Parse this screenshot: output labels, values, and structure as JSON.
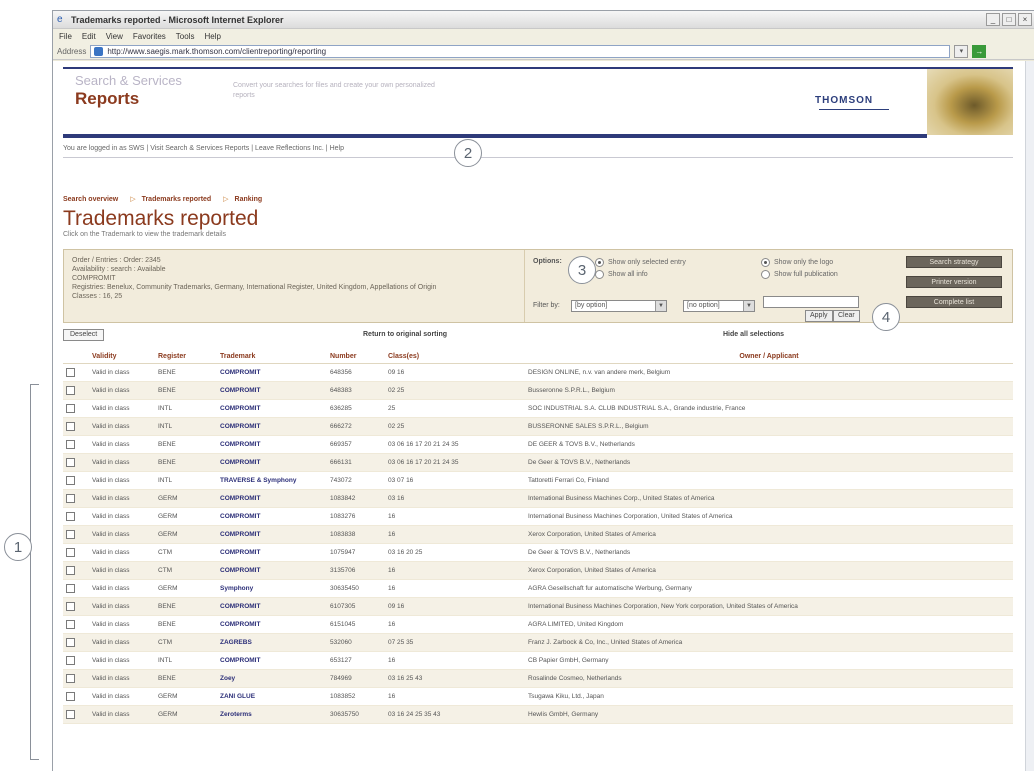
{
  "browser": {
    "title": "Trademarks reported - Microsoft Internet Explorer",
    "menu": [
      "File",
      "Edit",
      "View",
      "Favorites",
      "Tools",
      "Help"
    ],
    "address_label": "Address",
    "url": "http://www.saegis.mark.thomson.com/clientreporting/reporting"
  },
  "header": {
    "brand_small": "Search & Services",
    "brand_big": "Reports",
    "description": "Convert your searches for files and create your own personalized reports",
    "logo": "THOMSON"
  },
  "usernav": {
    "logged_in": "You are logged in as SWS",
    "links": [
      "Visit Search & Services Reports",
      "Leave Reflections Inc.",
      "Help"
    ]
  },
  "breadcrumb": [
    "Search overview",
    "Trademarks reported",
    "Ranking"
  ],
  "page": {
    "title": "Trademarks reported",
    "subtitle": "Click on the Trademark to view the trademark details"
  },
  "panel": {
    "info": [
      "Order / Entries : Order: 2345",
      "Availability : search : Available",
      "COMPROMIT",
      "Registries: Benelux, Community Trademarks, Germany, International Register, United Kingdom, Appellations of Origin",
      "Classes : 16, 25"
    ],
    "options_label": "Options:",
    "radios": [
      {
        "label": "Show only selected entry",
        "checked": true
      },
      {
        "label": "Show all info",
        "checked": false
      },
      {
        "label": "Show only the logo",
        "checked": true
      },
      {
        "label": "Show full publication",
        "checked": false
      }
    ],
    "filter_label": "Filter by:",
    "select1": "[by option]",
    "select2": "[no option]",
    "apply_label": "Apply",
    "clear_label": "Clear",
    "side_buttons": [
      "Search strategy",
      "Printer version",
      "Complete list"
    ]
  },
  "results": {
    "deselect_label": "Deselect",
    "sort_link": "Return to original sorting",
    "hide_link": "Hide all selections",
    "columns": [
      "",
      "Validity",
      "Register",
      "Trademark",
      "Number",
      "Class(es)",
      "Owner / Applicant"
    ],
    "rows": [
      {
        "validity": "Valid in class",
        "register": "BENE",
        "trademark": "COMPROMIT",
        "number": "648356",
        "classes": "09 16",
        "owner": "DESIGN ONLINE, n.v. van andere merk, Belgium"
      },
      {
        "validity": "Valid in class",
        "register": "BENE",
        "trademark": "COMPROMIT",
        "number": "648383",
        "classes": "02 25",
        "owner": "Busseronne S.P.R.L., Belgium"
      },
      {
        "validity": "Valid in class",
        "register": "INTL",
        "trademark": "COMPROMIT",
        "number": "636285",
        "classes": "25",
        "owner": "SOC INDUSTRIAL S.A. CLUB INDUSTRIAL S.A., Grande industrie, France"
      },
      {
        "validity": "Valid in class",
        "register": "INTL",
        "trademark": "COMPROMIT",
        "number": "666272",
        "classes": "02 25",
        "owner": "BUSSERONNE SALES S.P.R.L., Belgium"
      },
      {
        "validity": "Valid in class",
        "register": "BENE",
        "trademark": "COMPROMIT",
        "number": "669357",
        "classes": "03 06 16 17 20 21 24 35",
        "owner": "DE GEER & TOVS B.V., Netherlands"
      },
      {
        "validity": "Valid in class",
        "register": "BENE",
        "trademark": "COMPROMIT",
        "number": "666131",
        "classes": "03 06 16 17 20 21 24 35",
        "owner": "De Geer & TOVS B.V., Netherlands"
      },
      {
        "validity": "Valid in class",
        "register": "INTL",
        "trademark": "TRAVERSE & Symphony",
        "number": "743072",
        "classes": "03 07 16",
        "owner": "Tattoretti Ferrari Co, Finland"
      },
      {
        "validity": "Valid in class",
        "register": "GERM",
        "trademark": "COMPROMIT",
        "number": "1083842",
        "classes": "03 16",
        "owner": "International Business Machines Corp., United States of America"
      },
      {
        "validity": "Valid in class",
        "register": "GERM",
        "trademark": "COMPROMIT",
        "number": "1083276",
        "classes": "16",
        "owner": "International Business Machines Corporation, United States of America"
      },
      {
        "validity": "Valid in class",
        "register": "GERM",
        "trademark": "COMPROMIT",
        "number": "1083838",
        "classes": "16",
        "owner": "Xerox Corporation, United States of America"
      },
      {
        "validity": "Valid in class",
        "register": "CTM",
        "trademark": "COMPROMIT",
        "number": "1075947",
        "classes": "03 16 20 25",
        "owner": "De Geer & TOVS B.V., Netherlands"
      },
      {
        "validity": "Valid in class",
        "register": "CTM",
        "trademark": "COMPROMIT",
        "number": "3135706",
        "classes": "16",
        "owner": "Xerox Corporation, United States of America"
      },
      {
        "validity": "Valid in class",
        "register": "GERM",
        "trademark": "Symphony",
        "number": "30635450",
        "classes": "16",
        "owner": "AGRA Gesellschaft fur automatische Werbung, Germany"
      },
      {
        "validity": "Valid in class",
        "register": "BENE",
        "trademark": "COMPROMIT",
        "number": "6107305",
        "classes": "09 16",
        "owner": "International Business Machines Corporation, New York corporation, United States of America"
      },
      {
        "validity": "Valid in class",
        "register": "BENE",
        "trademark": "COMPROMIT",
        "number": "6151045",
        "classes": "16",
        "owner": "AGRA LIMITED, United Kingdom"
      },
      {
        "validity": "Valid in class",
        "register": "CTM",
        "trademark": "ZAGREBS",
        "number": "532060",
        "classes": "07 25 35",
        "owner": "Franz J. Zarbock & Co, Inc., United States of America"
      },
      {
        "validity": "Valid in class",
        "register": "INTL",
        "trademark": "COMPROMIT",
        "number": "653127",
        "classes": "16",
        "owner": "CB Papier GmbH, Germany"
      },
      {
        "validity": "Valid in class",
        "register": "BENE",
        "trademark": "Zoey",
        "number": "784969",
        "classes": "03 16 25 43",
        "owner": "Rosalinde Cosmeo, Netherlands"
      },
      {
        "validity": "Valid in class",
        "register": "GERM",
        "trademark": "ZANI GLUE",
        "number": "1083852",
        "classes": "16",
        "owner": "Tsugawa Kiku, Ltd., Japan"
      },
      {
        "validity": "Valid in class",
        "register": "GERM",
        "trademark": "Zeroterms",
        "number": "30635750",
        "classes": "03 16 24 25 35 43",
        "owner": "Hewlis GmbH, Germany"
      }
    ]
  },
  "callouts": [
    "1",
    "2",
    "3",
    "4"
  ]
}
